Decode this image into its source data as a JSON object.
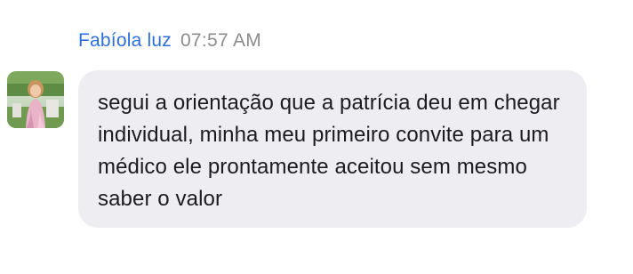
{
  "message": {
    "sender_name": "Fabíola luz",
    "timestamp": "07:57 AM",
    "avatar_icon": "user-photo-avatar",
    "text": "segui a orientação que a patrícia deu em chegar individual, minha meu primeiro convite para um médico ele prontamente aceitou sem mesmo saber o valor"
  },
  "colors": {
    "sender_name": "#2f6fdc",
    "timestamp": "#8c8c8c",
    "bubble_background": "#ededf2",
    "message_text": "#1c1c1e"
  }
}
